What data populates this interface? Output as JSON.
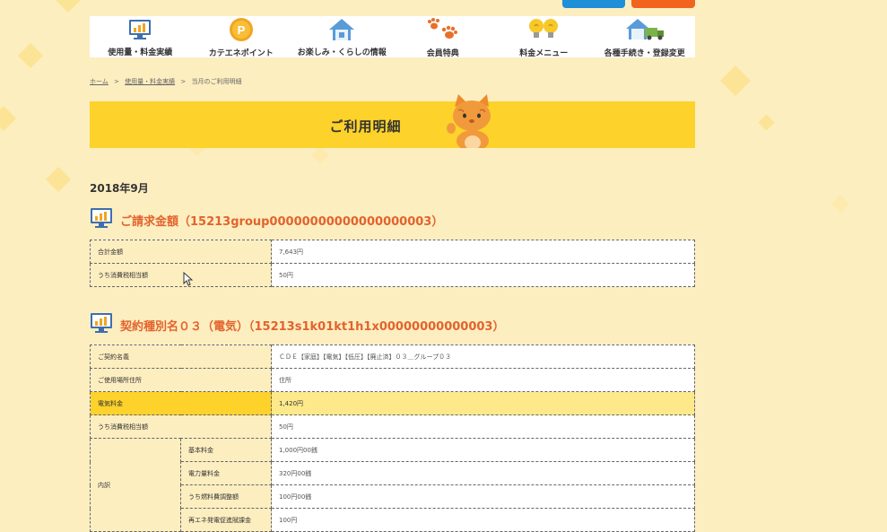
{
  "nav": {
    "items": [
      {
        "label": "使用量・料金実績",
        "icon": "chart-monitor-icon"
      },
      {
        "label": "カテエネポイント",
        "icon": "point-coin-icon"
      },
      {
        "label": "お楽しみ・くらしの情報",
        "icon": "house-icon"
      },
      {
        "label": "会員特典",
        "icon": "paw-icon"
      },
      {
        "label": "料金メニュー",
        "icon": "lightbulb-icon"
      },
      {
        "label": "各種手続き・登録変更",
        "icon": "house-truck-icon"
      }
    ]
  },
  "breadcrumb": {
    "home": "ホーム",
    "usage": "使用量・料金実績",
    "current": "当月のご利用明細",
    "sep": ">"
  },
  "banner": {
    "title": "ご利用明細"
  },
  "month": "2018年9月",
  "billing": {
    "heading": "ご請求金額（15213group00000000000000000003）",
    "rows": [
      {
        "label": "合計金額",
        "value": "7,643円"
      },
      {
        "label": "うち消費税相当額",
        "value": "50円"
      }
    ]
  },
  "contract": {
    "heading": "契約種別名０３（電気）（15213s1k01kt1h1x00000000000003）",
    "rows": [
      {
        "label": "ご契約名義",
        "value": "ＣＤＥ【家庭】【電気】【低圧】【廃止済】０３＿グループ０３"
      },
      {
        "label": "ご使用場所住所",
        "value": "住所"
      },
      {
        "label": "電気料金",
        "value": "1,420円"
      },
      {
        "label": "うち消費税相当額",
        "value": "50円"
      }
    ],
    "breakdown_label": "内訳",
    "breakdown": [
      {
        "label": "基本料金",
        "value": "1,000円00銭"
      },
      {
        "label": "電力量料金",
        "value": "320円00銭"
      },
      {
        "label": "うち燃料費調整額",
        "value": "100円00銭"
      },
      {
        "label": "再エネ発電促進賦課金",
        "value": "100円"
      }
    ]
  },
  "colors": {
    "background": "#fdeec0",
    "banner": "#fdd22a",
    "heading": "#e2632d",
    "blue_button": "#1f8fd8",
    "orange_button": "#f2641e"
  }
}
